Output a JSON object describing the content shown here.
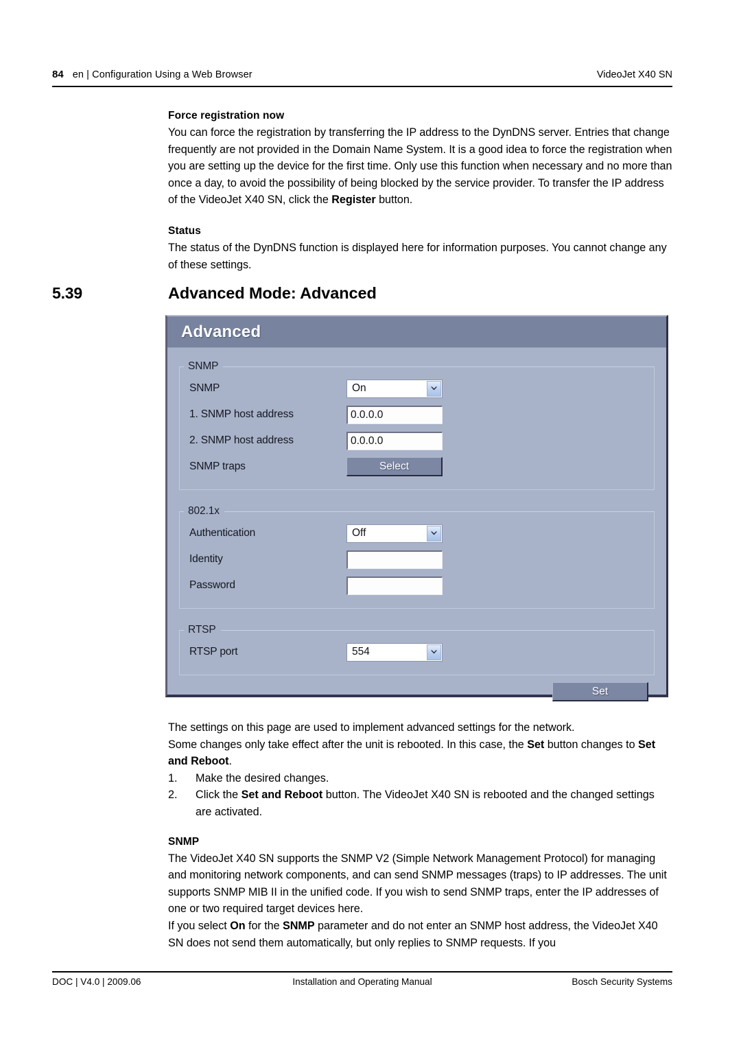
{
  "header": {
    "page_number": "84",
    "chapter": "en | Configuration Using a Web Browser",
    "product": "VideoJet X40 SN"
  },
  "content": {
    "force_registration_heading": "Force registration now",
    "force_registration_p1": "You can force the registration by transferring the IP address to the DynDNS server. Entries that change frequently are not provided in the Domain Name System. It is a good idea to force the registration when you are setting up the device for the first time. Only use this function when necessary and no more than once a day, to avoid the possibility of being blocked by the service provider. To transfer the IP address of the VideoJet X40 SN, click the ",
    "force_registration_p1_bold": "Register",
    "force_registration_p1_end": " button.",
    "status_heading": "Status",
    "status_p1": "The status of the DynDNS function is displayed here for information purposes. You cannot change any of these settings."
  },
  "section": {
    "number": "5.39",
    "title": "Advanced Mode: Advanced"
  },
  "screenshot": {
    "title": "Advanced",
    "groups": [
      {
        "legend": "SNMP",
        "rows": [
          {
            "label": "SNMP",
            "control": "select",
            "value": "On"
          },
          {
            "label": "1. SNMP host address",
            "control": "text",
            "value": "0.0.0.0"
          },
          {
            "label": "2. SNMP host address",
            "control": "text",
            "value": "0.0.0.0"
          },
          {
            "label": "SNMP traps",
            "control": "button",
            "value": "Select"
          }
        ]
      },
      {
        "legend": "802.1x",
        "rows": [
          {
            "label": "Authentication",
            "control": "select",
            "value": "Off"
          },
          {
            "label": "Identity",
            "control": "text",
            "value": ""
          },
          {
            "label": "Password",
            "control": "text",
            "value": ""
          }
        ]
      },
      {
        "legend": "RTSP",
        "rows": [
          {
            "label": "RTSP port",
            "control": "select",
            "value": "554"
          }
        ]
      }
    ],
    "set_button": "Set",
    "colors": {
      "titlebar": "#78839f",
      "body": "#a8b3c9",
      "button": "#7c87a4"
    }
  },
  "below": {
    "p1": "The settings on this page are used to implement advanced settings for the network.",
    "p2_a": "Some changes only take effect after the unit is rebooted. In this case, the ",
    "p2_b1": "Set",
    "p2_b": " button changes to ",
    "p2_b2": "Set and Reboot",
    "p2_c": ".",
    "steps": [
      {
        "num": "1.",
        "a": "Make the desired changes.",
        "bold": "",
        "b": ""
      },
      {
        "num": "2.",
        "a": "Click the ",
        "bold": "Set and Reboot",
        "b": " button. The VideoJet X40 SN is rebooted and the changed settings are activated."
      }
    ],
    "snmp_heading": "SNMP",
    "snmp_p1": "The VideoJet X40 SN supports the SNMP V2 (Simple Network Management Protocol) for managing and monitoring network components, and can send SNMP messages (traps) to IP addresses. The unit supports SNMP MIB II in the unified code. If you wish to send SNMP traps, enter the IP addresses of one or two required target devices here.",
    "snmp_p2_a": "If you select ",
    "snmp_p2_b1": "On",
    "snmp_p2_b": " for the ",
    "snmp_p2_b2": "SNMP",
    "snmp_p2_c": " parameter and do not enter an SNMP host address, the VideoJet X40 SN does not send them automatically, but only replies to SNMP requests. If you"
  },
  "footer": {
    "left": "DOC | V4.0 | 2009.06",
    "middle": "Installation and Operating Manual",
    "right": "Bosch Security Systems"
  }
}
